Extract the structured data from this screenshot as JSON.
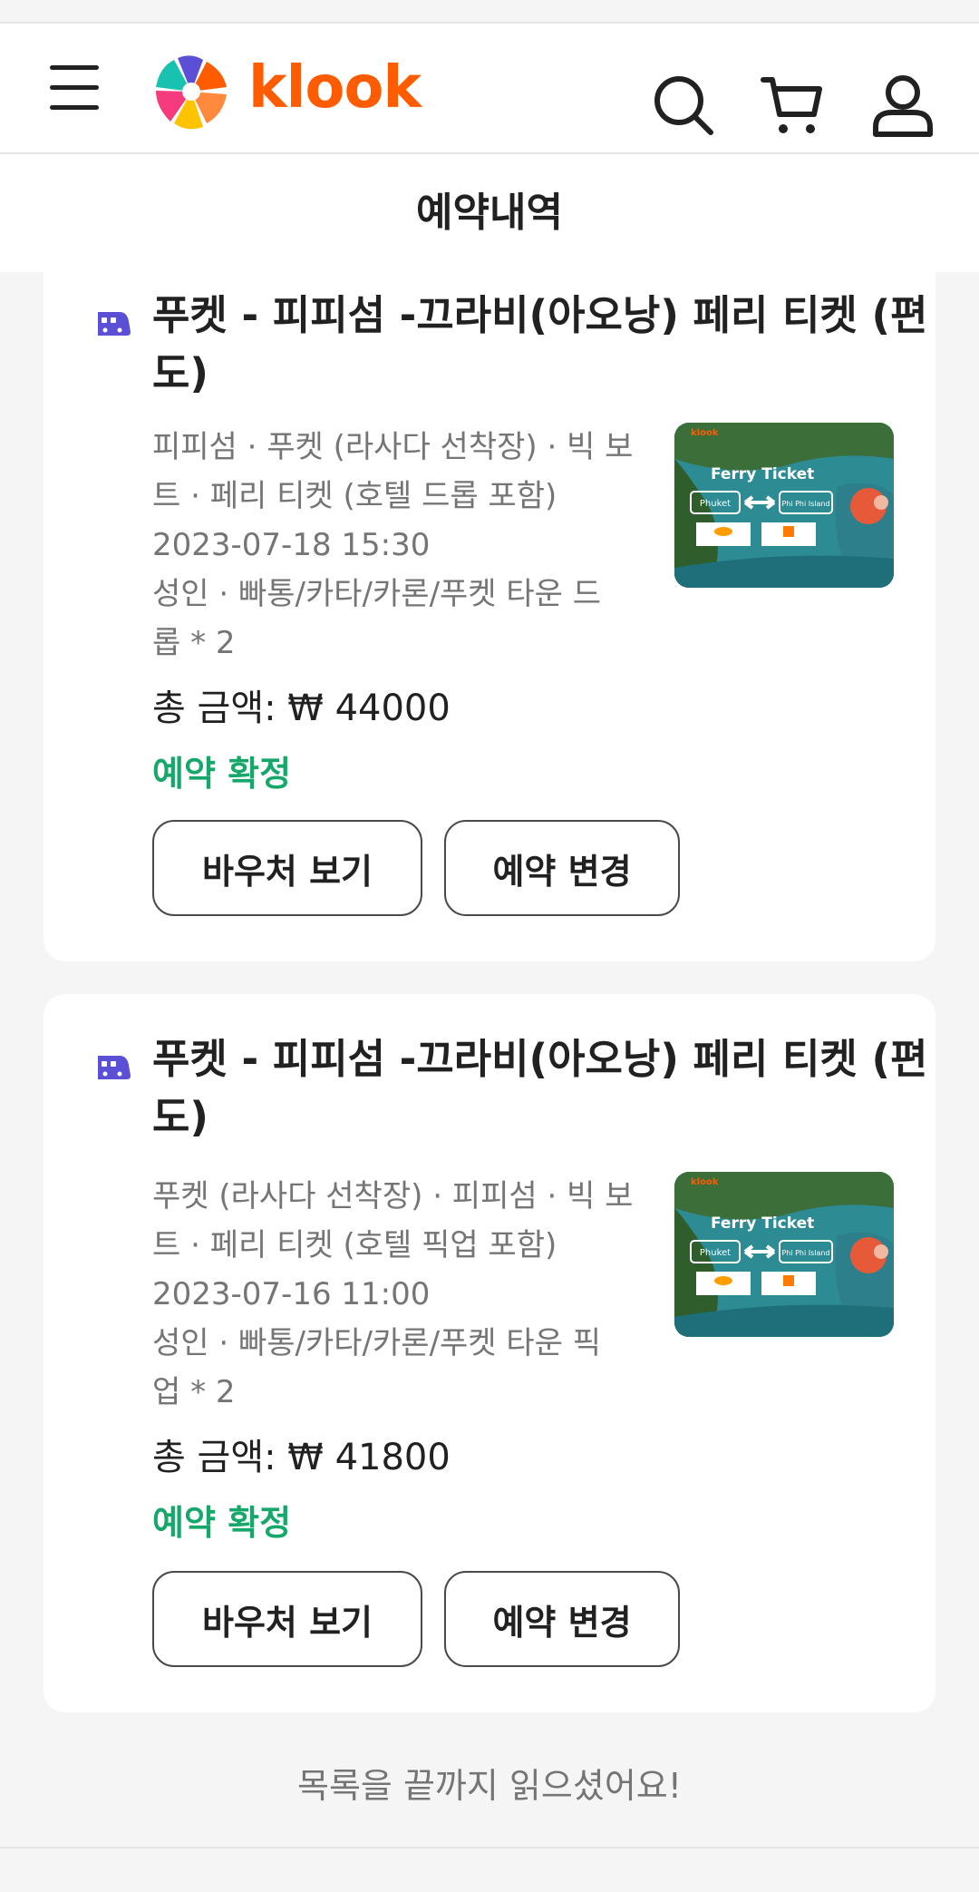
{
  "header": {
    "logo_text": "klook",
    "icons": [
      "menu-icon",
      "search-icon",
      "cart-icon",
      "user-icon"
    ]
  },
  "page": {
    "title": "예약내역"
  },
  "bookings": [
    {
      "title": "푸켓 - 피피섬 -끄라비(아오낭) 페리 티켓 (편도)",
      "desc_line1": "피피섬 · 푸켓 (라사다 선착장) · 빅 보",
      "desc_line2": "트 · 페리 티켓 (호텔 드롭 포함)",
      "datetime": "2023-07-18 15:30",
      "pax_line1": "성인 · 빠통/카타/카론/푸켓 타운 드",
      "pax_line2": "롭 * 2",
      "price": "총 금액: ₩ 44000",
      "status": "예약 확정",
      "voucher_label": "바우처 보기",
      "change_label": "예약 변경",
      "thumb": {
        "title": "Ferry Ticket",
        "from": "Phuket",
        "to": "Phi Phi Island",
        "brand": "klook"
      }
    },
    {
      "title": "푸켓 - 피피섬 -끄라비(아오낭) 페리 티켓 (편도)",
      "desc_line1": "푸켓 (라사다 선착장) · 피피섬 · 빅 보",
      "desc_line2": "트 · 페리 티켓 (호텔 픽업 포함)",
      "datetime": "2023-07-16 11:00",
      "pax_line1": "성인 · 빠통/카타/카론/푸켓 타운 픽",
      "pax_line2": "업 * 2",
      "price": "총 금액: ₩ 41800",
      "status": "예약 확정",
      "voucher_label": "바우처 보기",
      "change_label": "예약 변경",
      "thumb": {
        "title": "Ferry Ticket",
        "from": "Phuket",
        "to": "Phi Phi Island",
        "brand": "klook"
      }
    }
  ],
  "footer": {
    "end_text": "목록을 끝까지 읽으셨어요!"
  },
  "colors": {
    "brand": "#ff5b00",
    "confirmed": "#16a86b",
    "ferry_icon": "#5b4fd6"
  }
}
